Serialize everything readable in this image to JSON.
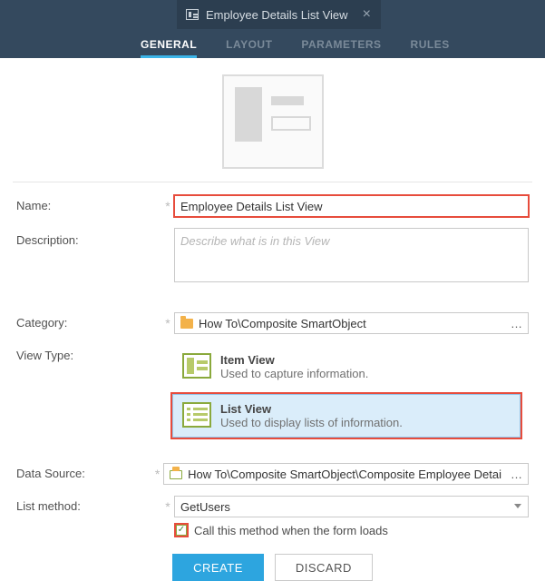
{
  "header": {
    "tab_title": "Employee Details List View"
  },
  "nav": {
    "general": "GENERAL",
    "layout": "LAYOUT",
    "parameters": "PARAMETERS",
    "rules": "RULES"
  },
  "labels": {
    "name": "Name:",
    "description": "Description:",
    "category": "Category:",
    "view_type": "View Type:",
    "data_source": "Data Source:",
    "list_method": "List method:"
  },
  "fields": {
    "name_value": "Employee Details List View",
    "description_value": "",
    "description_placeholder": "Describe what is in this View",
    "category_value": "How To\\Composite SmartObject",
    "data_source_value": "How To\\Composite SmartObject\\Composite Employee Detai",
    "list_method_selected": "GetUsers",
    "list_method_options": [
      "GetUsers"
    ],
    "call_on_load_label": "Call this method when the form loads",
    "call_on_load_checked": true
  },
  "view_types": {
    "item": {
      "title": "Item View",
      "subtitle": "Used to capture information."
    },
    "list": {
      "title": "List View",
      "subtitle": "Used to display lists of information."
    },
    "selected": "list"
  },
  "buttons": {
    "create": "CREATE",
    "discard": "DISCARD"
  },
  "glyphs": {
    "star": "*",
    "ellipsis": "…",
    "close": "×",
    "check": "✓"
  }
}
